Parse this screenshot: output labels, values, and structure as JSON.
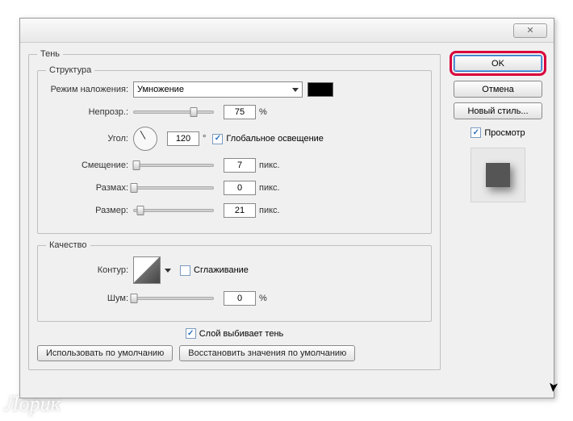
{
  "window": {
    "close": "✕"
  },
  "sections": {
    "shadow": "Тень",
    "structure": "Структура",
    "quality": "Качество"
  },
  "labels": {
    "blend_mode": "Режим наложения:",
    "opacity": "Непрозр.:",
    "angle": "Угол:",
    "offset": "Смещение:",
    "spread": "Размах:",
    "size": "Размер:",
    "contour": "Контур:",
    "noise": "Шум:",
    "global_light": "Глобальное освещение",
    "antialias": "Сглаживание",
    "knockout": "Слой выбивает тень",
    "deg": "°",
    "px": "пикс.",
    "pct": "%"
  },
  "values": {
    "blend_mode": "Умножение",
    "opacity": "75",
    "angle": "120",
    "offset": "7",
    "spread": "0",
    "size": "21",
    "noise": "0",
    "global_light_checked": true,
    "antialias_checked": false,
    "knockout_checked": true,
    "preview_checked": true
  },
  "sliders": {
    "opacity_pct": 75,
    "offset_pct": 3,
    "spread_pct": 0,
    "size_pct": 8,
    "noise_pct": 0
  },
  "buttons": {
    "use_defaults": "Использовать по умолчанию",
    "restore_defaults": "Восстановить значения по умолчанию",
    "ok": "OK",
    "cancel": "Отмена",
    "new_style": "Новый стиль...",
    "preview": "Просмотр"
  },
  "watermark": "Лорик"
}
